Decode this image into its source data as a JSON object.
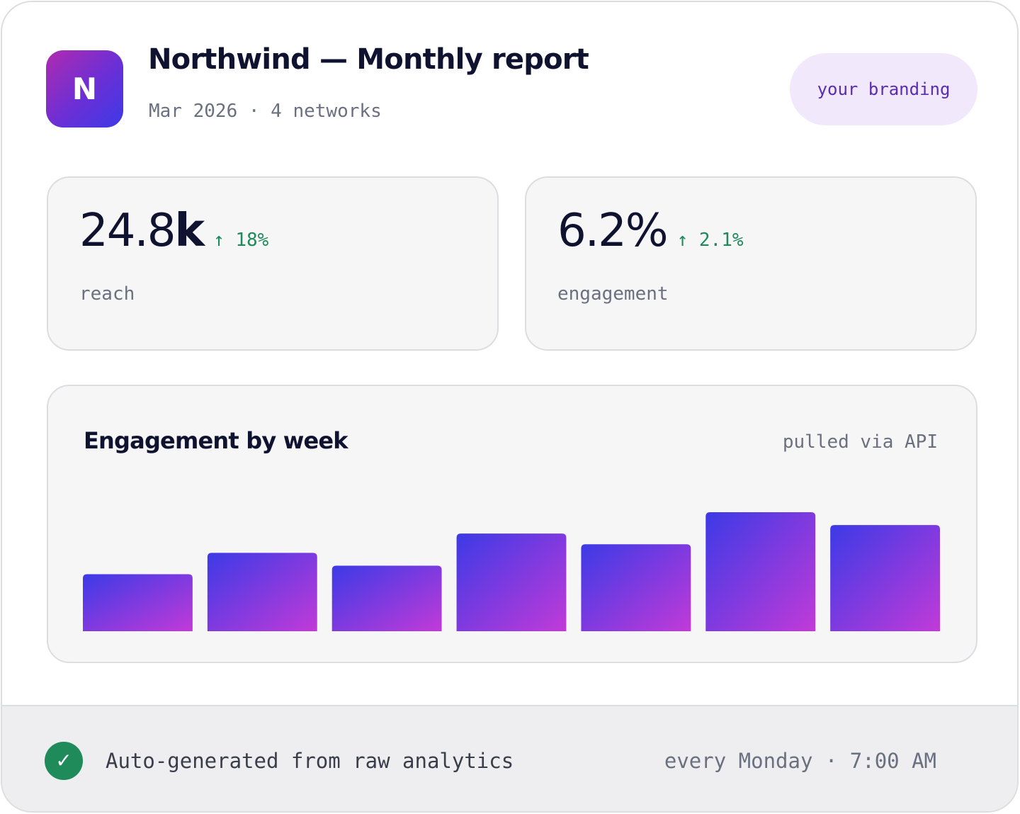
{
  "header": {
    "logo_letter": "N",
    "title": "Northwind — Monthly report",
    "subtitle": "Mar 2026 · 4 networks",
    "branding_label": "your branding"
  },
  "metrics": [
    {
      "value": "24.8",
      "unit": "k",
      "delta": "↑ 18%",
      "label": "reach"
    },
    {
      "value": "6.2",
      "unit": "%",
      "delta": "↑ 2.1%",
      "label": "engagement"
    }
  ],
  "chart": {
    "title": "Engagement by week",
    "source": "pulled via API"
  },
  "chart_data": {
    "type": "bar",
    "title": "Engagement by week",
    "categories": [
      "",
      "",
      "",
      "",
      "",
      "",
      ""
    ],
    "values": [
      80,
      110,
      92,
      137,
      122,
      167,
      149
    ],
    "ylim": [
      0,
      167
    ],
    "grid": false,
    "legend": "none"
  },
  "footer": {
    "text": "Auto-generated from raw analytics",
    "schedule": "every Monday · 7:00 AM",
    "check_icon": "✓"
  },
  "colors": {
    "accent_start": "#3c3ae6",
    "accent_end": "#c23ad8",
    "positive": "#1e8a5a",
    "text_dark": "#0f1330",
    "text_muted": "#6b7080"
  }
}
